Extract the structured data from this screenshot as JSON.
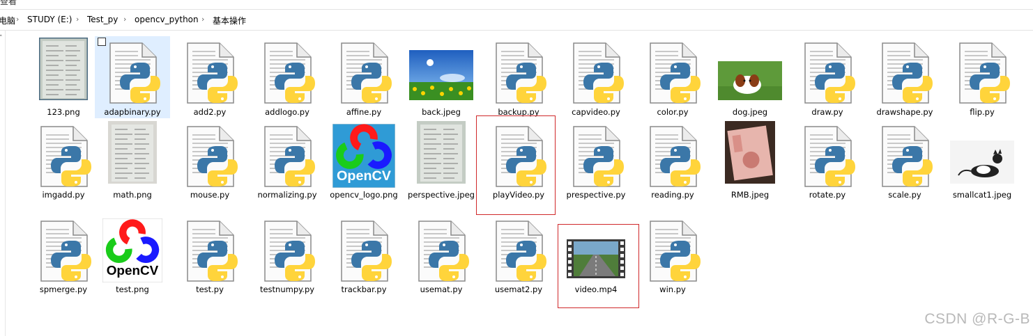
{
  "window": {
    "partial_title": "查看"
  },
  "breadcrumb": {
    "items": [
      "电脑",
      "STUDY (E:)",
      "Test_py",
      "opencv_python",
      "基本操作"
    ]
  },
  "files": [
    {
      "name": "123.png",
      "icon": "photo-thumbnail"
    },
    {
      "name": "adapbinary.py",
      "icon": "python-file",
      "selected": true
    },
    {
      "name": "add2.py",
      "icon": "python-file"
    },
    {
      "name": "addlogo.py",
      "icon": "python-file"
    },
    {
      "name": "affine.py",
      "icon": "python-file"
    },
    {
      "name": "back.jpeg",
      "icon": "photo-thumbnail"
    },
    {
      "name": "backup.py",
      "icon": "python-file"
    },
    {
      "name": "capvideo.py",
      "icon": "python-file"
    },
    {
      "name": "color.py",
      "icon": "python-file"
    },
    {
      "name": "dog.jpeg",
      "icon": "photo-thumbnail"
    },
    {
      "name": "draw.py",
      "icon": "python-file"
    },
    {
      "name": "drawshape.py",
      "icon": "python-file"
    },
    {
      "name": "flip.py",
      "icon": "python-file"
    },
    {
      "name": "imgadd.py",
      "icon": "python-file"
    },
    {
      "name": "math.png",
      "icon": "photo-thumbnail"
    },
    {
      "name": "mouse.py",
      "icon": "python-file"
    },
    {
      "name": "normalizing.py",
      "icon": "python-file"
    },
    {
      "name": "opencv_logo.png",
      "icon": "opencv-logo"
    },
    {
      "name": "perspective.jpeg",
      "icon": "photo-thumbnail"
    },
    {
      "name": "playVideo.py",
      "icon": "python-file",
      "highlighted": true
    },
    {
      "name": "prespective.py",
      "icon": "python-file"
    },
    {
      "name": "reading.py",
      "icon": "python-file"
    },
    {
      "name": "RMB.jpeg",
      "icon": "photo-thumbnail"
    },
    {
      "name": "rotate.py",
      "icon": "python-file"
    },
    {
      "name": "scale.py",
      "icon": "python-file"
    },
    {
      "name": "smallcat1.jpeg",
      "icon": "photo-thumbnail"
    },
    {
      "name": "spmerge.py",
      "icon": "python-file"
    },
    {
      "name": "test.png",
      "icon": "opencv-logo"
    },
    {
      "name": "test.py",
      "icon": "python-file"
    },
    {
      "name": "testnumpy.py",
      "icon": "python-file"
    },
    {
      "name": "trackbar.py",
      "icon": "python-file"
    },
    {
      "name": "usemat.py",
      "icon": "python-file"
    },
    {
      "name": "usemat2.py",
      "icon": "python-file"
    },
    {
      "name": "video.mp4",
      "icon": "video-thumbnail",
      "highlighted": true
    },
    {
      "name": "win.py",
      "icon": "python-file"
    }
  ],
  "watermark": "CSDN @R-G-B",
  "colors": {
    "highlight": "#d0282a",
    "selection": "#dfeeff",
    "python_blue": "#3b77a8",
    "python_yellow": "#ffd43b"
  }
}
